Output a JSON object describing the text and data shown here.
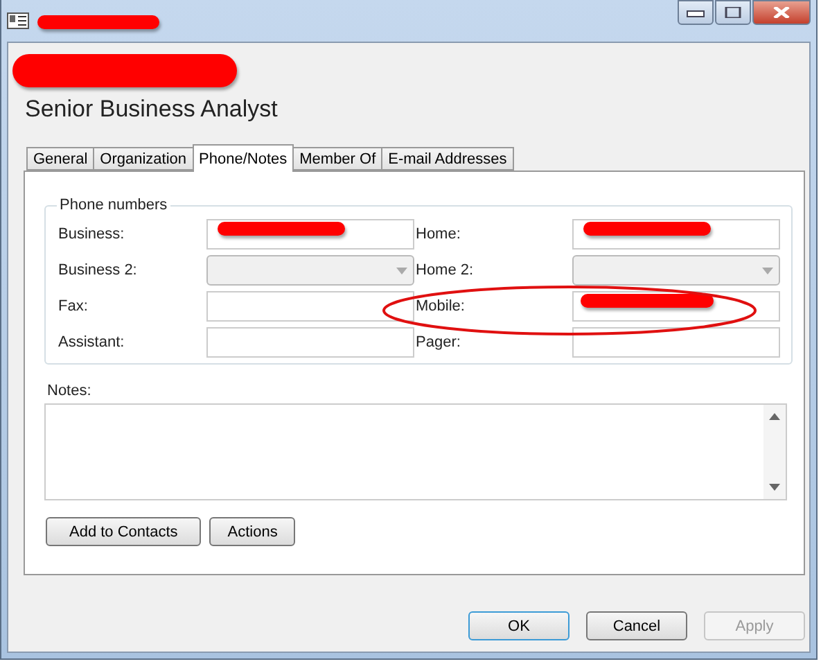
{
  "window": {
    "title_redacted": true,
    "name_redacted": true
  },
  "job_title": "Senior Business Analyst",
  "tabs": [
    {
      "label": "General",
      "selected": false
    },
    {
      "label": "Organization",
      "selected": false
    },
    {
      "label": "Phone/Notes",
      "selected": true
    },
    {
      "label": "Member Of",
      "selected": false
    },
    {
      "label": "E-mail Addresses",
      "selected": false
    }
  ],
  "phone_group": {
    "title": "Phone numbers",
    "fields": [
      {
        "label": "Business:",
        "kind": "text",
        "redacted": true,
        "disabled": false,
        "highlighted": false
      },
      {
        "label": "Home:",
        "kind": "text",
        "redacted": true,
        "disabled": false,
        "highlighted": false
      },
      {
        "label": "Business 2:",
        "kind": "dropdown",
        "redacted": false,
        "disabled": true,
        "highlighted": false
      },
      {
        "label": "Home 2:",
        "kind": "dropdown",
        "redacted": false,
        "disabled": true,
        "highlighted": false
      },
      {
        "label": "Fax:",
        "kind": "text",
        "redacted": false,
        "disabled": false,
        "highlighted": false
      },
      {
        "label": "Mobile:",
        "kind": "text",
        "redacted": true,
        "disabled": false,
        "highlighted": true
      },
      {
        "label": "Assistant:",
        "kind": "text",
        "redacted": false,
        "disabled": false,
        "highlighted": false
      },
      {
        "label": "Pager:",
        "kind": "text",
        "redacted": false,
        "disabled": false,
        "highlighted": false
      }
    ]
  },
  "notes": {
    "label": "Notes:"
  },
  "panel_buttons": [
    "Add to Contacts",
    "Actions"
  ],
  "dialog_buttons": [
    {
      "label": "OK",
      "default": true,
      "disabled": false
    },
    {
      "label": "Cancel",
      "default": false,
      "disabled": false
    },
    {
      "label": "Apply",
      "default": false,
      "disabled": true
    }
  ]
}
